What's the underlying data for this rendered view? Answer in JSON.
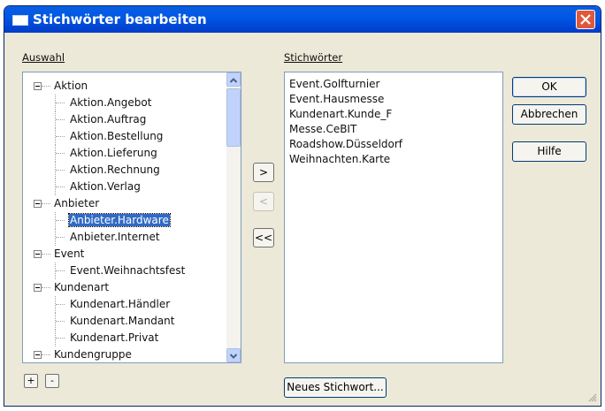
{
  "window": {
    "title": "Stichwörter bearbeiten"
  },
  "labels": {
    "selection": "Auswahl",
    "keywords": "Stichwörter"
  },
  "tree": {
    "nodes": [
      {
        "text": "Aktion",
        "level": 0,
        "expanded": true
      },
      {
        "text": "Aktion.Angebot",
        "level": 1
      },
      {
        "text": "Aktion.Auftrag",
        "level": 1
      },
      {
        "text": "Aktion.Bestellung",
        "level": 1
      },
      {
        "text": "Aktion.Lieferung",
        "level": 1
      },
      {
        "text": "Aktion.Rechnung",
        "level": 1
      },
      {
        "text": "Aktion.Verlag",
        "level": 1
      },
      {
        "text": "Anbieter",
        "level": 0,
        "expanded": true
      },
      {
        "text": "Anbieter.Hardware",
        "level": 1,
        "selected": true
      },
      {
        "text": "Anbieter.Internet",
        "level": 1
      },
      {
        "text": "Event",
        "level": 0,
        "expanded": true
      },
      {
        "text": "Event.Weihnachtsfest",
        "level": 1
      },
      {
        "text": "Kundenart",
        "level": 0,
        "expanded": true
      },
      {
        "text": "Kundenart.Händler",
        "level": 1
      },
      {
        "text": "Kundenart.Mandant",
        "level": 1
      },
      {
        "text": "Kundenart.Privat",
        "level": 1
      },
      {
        "text": "Kundengruppe",
        "level": 0,
        "expanded": true
      }
    ]
  },
  "tree_buttons": {
    "expand": "+",
    "collapse": "-"
  },
  "transfer_buttons": {
    "add": ">",
    "remove": "<",
    "remove_all": "<<"
  },
  "keyword_list": {
    "items": [
      "Event.Golfturnier",
      "Event.Hausmesse",
      "Kundenart.Kunde_F",
      "Messe.CeBIT",
      "Roadshow.Düsseldorf",
      "Weihnachten.Karte"
    ]
  },
  "buttons": {
    "ok": "OK",
    "cancel": "Abbrechen",
    "help": "Hilfe",
    "new_keyword": "Neues Stichwort..."
  },
  "colors": {
    "title_bar": "#0058e6",
    "selection": "#316ac5",
    "dialog_bg": "#ece9d8",
    "close": "#e0583a"
  }
}
